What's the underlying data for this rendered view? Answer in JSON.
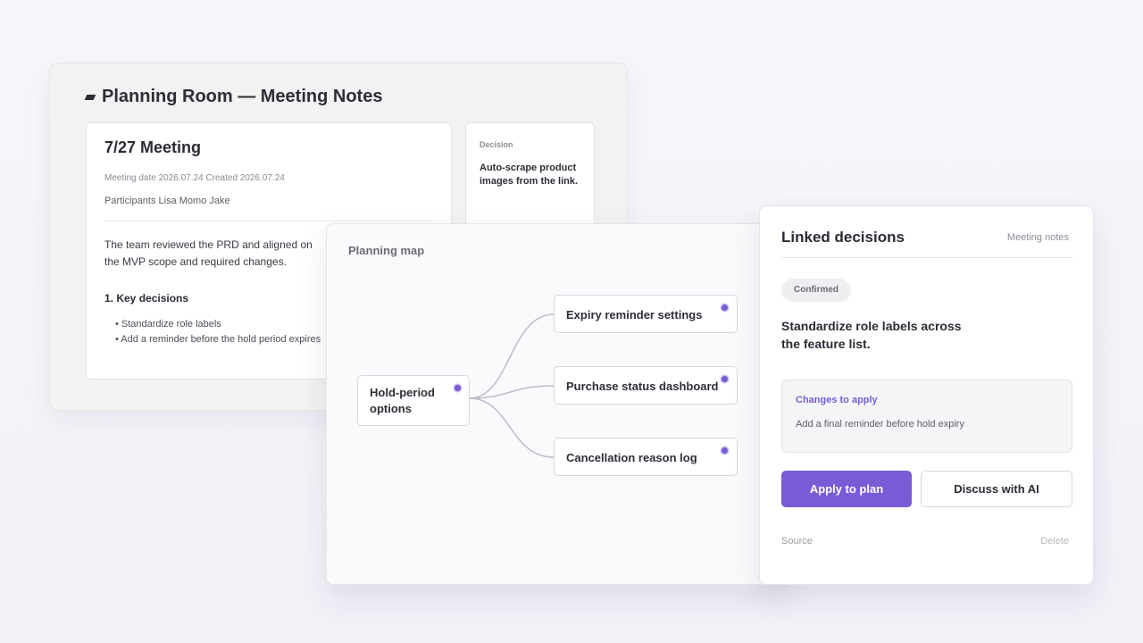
{
  "notes_window": {
    "title": "Planning Room — Meeting Notes",
    "title_icon": "document-icon",
    "meeting": {
      "heading": "7/27 Meeting",
      "meta": "Meeting date 2026.07.24 Created 2026.07.24",
      "participants": "Participants Lisa Momo Jake",
      "summary": "The team reviewed the PRD and aligned on the MVP scope and required changes.",
      "section_heading": "1. Key decisions",
      "bullets": [
        "• Standardize role labels",
        "• Add a reminder before the hold period expires"
      ]
    },
    "decision_card": {
      "label": "Decision",
      "text": "Auto-scrape product images from the link."
    }
  },
  "planning_map": {
    "title": "Planning map",
    "root_node": "Hold-period options",
    "child_nodes": [
      "Expiry reminder settings",
      "Purchase status dashboard",
      "Cancellation reason log"
    ],
    "node_dot_color": "#7a5bd6",
    "link_color": "#bdbbcc"
  },
  "linked_panel": {
    "title": "Linked decisions",
    "source_tag": "Meeting notes",
    "status_badge": "Confirmed",
    "decision_statement": "Standardize role labels across the feature list.",
    "changes_label": "Changes to apply",
    "changes_text": "Add a final reminder before hold expiry",
    "apply_button": "Apply to plan",
    "discuss_button": "Discuss with AI",
    "source_link": "Source",
    "delete_link": "Delete",
    "accent_color": "#7a5bd6"
  }
}
